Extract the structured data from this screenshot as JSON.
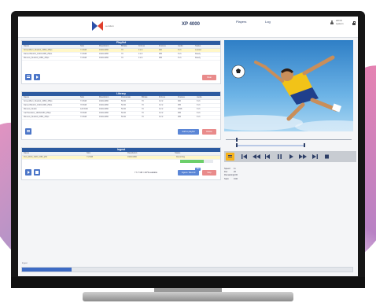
{
  "colors": {
    "accent": "#2c5aa0",
    "highlight": "#fff7c8",
    "transport_active": "#f6b21a",
    "progress": "#6ccf6a"
  },
  "header": {
    "brand": "a.cotton",
    "product": "XP 4000",
    "nav": [
      {
        "label": "Players"
      },
      {
        "label": "Log"
      }
    ],
    "user": {
      "name": "admin",
      "role": "system"
    }
  },
  "playlist": {
    "title": "Playlist",
    "columns": [
      "Name",
      "Size",
      "Resolution",
      "Bitrate",
      "Fr/Line",
      "Frames",
      "Audio",
      "Status"
    ],
    "rows": [
      [
        "ScreenBurn_Studio1_1080i_25fps",
        "71.5GB",
        "1920x1080",
        "70",
        "4:2:2",
        "900",
        "8 ch",
        "Loaded"
      ],
      [
        "DancerPlant01_1920x1080_25fps",
        "71.5GB",
        "1920x1080",
        "70",
        "4:2:2",
        "965",
        "8 ch",
        "Ready"
      ],
      [
        "Minerva_Studio2_1080i_25fps",
        "71.5GB",
        "1920x1080",
        "70",
        "4:2:2",
        "965",
        "8 ch",
        "Ready"
      ]
    ],
    "clear_label": "Clear"
  },
  "library": {
    "title": "Library",
    "columns": [
      "Name",
      "Size",
      "Resolution",
      "Framerate",
      "Bitrate",
      "Fr/Line",
      "Frames",
      "Audio"
    ],
    "rows": [
      [
        "ScreenBurn_Studio1_1080i_25fps",
        "71.5GB",
        "1920x1080",
        "50.00",
        "70",
        "4:2:2",
        "900",
        "8 ch"
      ],
      [
        "DancerPlant01_1920x1080_25fps",
        "70.5GB",
        "1920x1080",
        "50.00",
        "70",
        "4:2:2",
        "965",
        "8 ch"
      ],
      [
        "Minerva_Studio",
        "122.5GB",
        "1920x1080",
        "50.00",
        "70",
        "4:2:2",
        "1848",
        "8 ch"
      ],
      [
        "CarTransition_1920x1080_25fps",
        "70.5GB",
        "1920x1080",
        "50.00",
        "70",
        "4:2:2",
        "965",
        "8 ch"
      ],
      [
        "Minerva_Studio2_1080i_25fps",
        "71.5GB",
        "1920x1080",
        "50.00",
        "70",
        "4:2:2",
        "965",
        "8 ch"
      ]
    ],
    "add_label": "Add to playlist",
    "delete_label": "Delete"
  },
  "ingest": {
    "title": "Ingest",
    "columns": [
      "Name",
      "Size",
      "Resolution",
      "Status"
    ],
    "rows": [
      [
        "Port_4K00_1920_1080_p50",
        "71.5GB",
        "1920x1080",
        "Recording"
      ]
    ],
    "progress_fraction": 0.72,
    "available_text": "7 h 7 GB / 4079 available",
    "ingest_label": "Ingest / Record",
    "stop_label": "Stop",
    "badge_text": "Ext"
  },
  "player": {
    "meta": [
      {
        "label": "Speed",
        "value": "1x"
      },
      {
        "label": "Dur",
        "value": "20"
      },
      {
        "label": "Remaining",
        "value": "1:00"
      },
      {
        "label": "Start",
        "value": "0:00"
      }
    ],
    "scrub_position": 0.08,
    "range_start": 0.08,
    "range_end": 0.62
  },
  "timeline": {
    "label": "Ingest",
    "fraction": 0.15
  }
}
